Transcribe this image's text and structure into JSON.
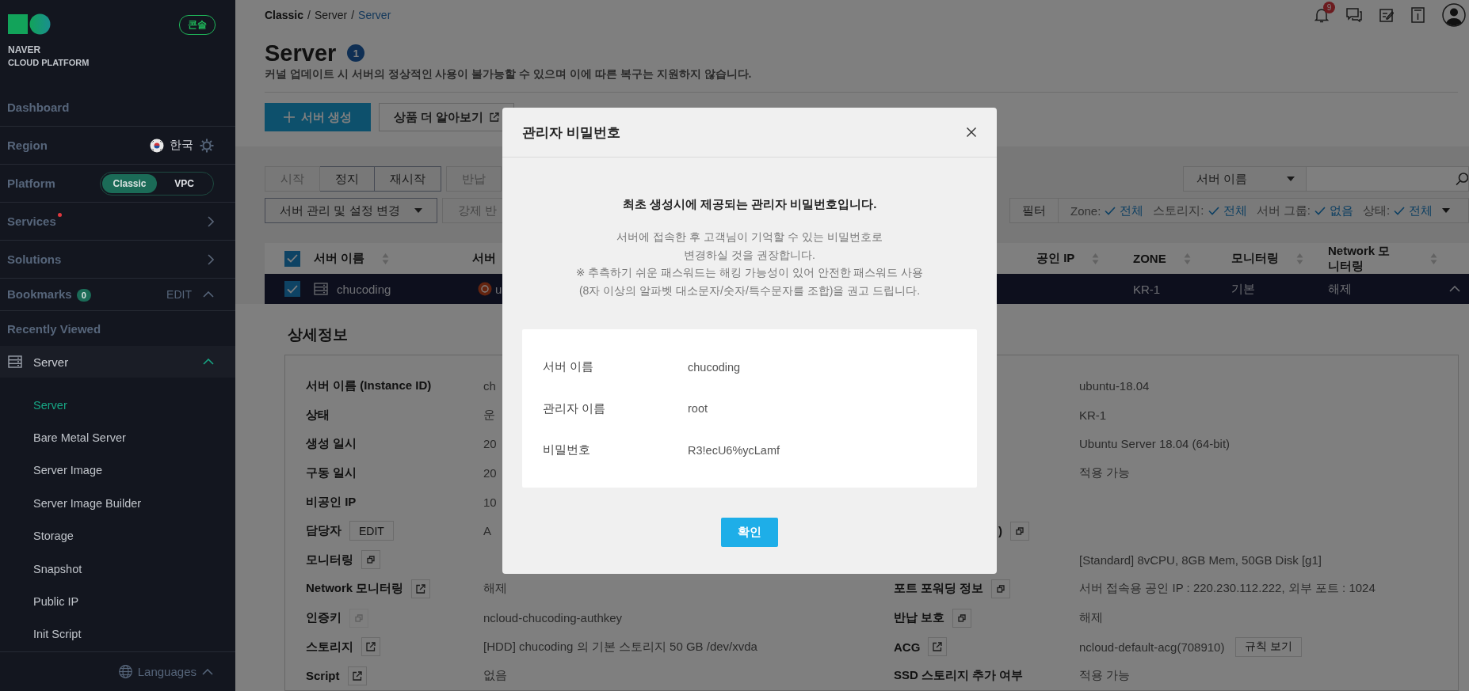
{
  "sidebar": {
    "brand": [
      "NAVER",
      "CLOUD PLATFORM"
    ],
    "console_badge": "콘솔",
    "menu": [
      {
        "kind": "link",
        "label": "Dashboard"
      },
      {
        "kind": "region",
        "label": "Region",
        "value": "한국"
      },
      {
        "kind": "platform",
        "label": "Platform",
        "options": [
          {
            "label": "Classic",
            "selected": true
          },
          {
            "label": "VPC",
            "selected": false
          }
        ]
      },
      {
        "kind": "expander",
        "label": "Services",
        "new": true
      },
      {
        "kind": "expander",
        "label": "Solutions",
        "new": false
      },
      {
        "kind": "bookmarks",
        "label": "Bookmarks",
        "count": "0",
        "action": "EDIT",
        "expanded": true
      },
      {
        "kind": "link",
        "label": "Recently Viewed"
      }
    ],
    "group": {
      "label": "Server",
      "expanded": true,
      "children": [
        {
          "label": "Server",
          "selected": true
        },
        {
          "label": "Bare Metal Server",
          "selected": false
        },
        {
          "label": "Server Image",
          "selected": false
        },
        {
          "label": "Server Image Builder",
          "selected": false
        },
        {
          "label": "Storage",
          "selected": false
        },
        {
          "label": "Snapshot",
          "selected": false
        },
        {
          "label": "Public IP",
          "selected": false
        },
        {
          "label": "Init Script",
          "selected": false
        }
      ]
    },
    "footer": "Languages"
  },
  "breadcrumb": {
    "separator": "/",
    "items": [
      {
        "label": "Classic",
        "current": false
      },
      {
        "label": "Server",
        "current": false
      },
      {
        "label": "Server",
        "current": true
      }
    ]
  },
  "header": {
    "notifications": "9"
  },
  "page": {
    "title": "Server",
    "count": "1",
    "notice": "커널 업데이트 시 서버의 정상적인 사용이 불가능할 수 있으며 이에 따른 복구는 지원하지 않습니다."
  },
  "actions": [
    {
      "kind": "primary",
      "label": "서버 생성"
    },
    {
      "kind": "external",
      "label": "상품 더 알아보기"
    }
  ],
  "toolbar": {
    "row_1": [
      [
        {
          "label": "시작",
          "disabled": true
        },
        {
          "label": "정지",
          "disabled": false
        },
        {
          "label": "재시작",
          "disabled": false
        }
      ],
      [
        {
          "label": "반납",
          "disabled": true
        }
      ]
    ],
    "row_2": [
      [
        {
          "label": "서버 관리 및 설정 변경",
          "kind": "dropdown",
          "disabled": false
        }
      ],
      [
        {
          "label": "강제 반",
          "kind": "plain",
          "disabled": true
        }
      ]
    ]
  },
  "search": {
    "scope": "서버 이름"
  },
  "filter": {
    "button": "필터",
    "items": [
      {
        "name": "Zone:",
        "value": "전체"
      },
      {
        "name": "스토리지:",
        "value": "전체"
      },
      {
        "name": "서버 그룹:",
        "value": "없음"
      },
      {
        "name": "상태:",
        "value": "전체"
      }
    ]
  },
  "table": {
    "all_checked": true,
    "columns": [
      {
        "label": "서버 이름",
        "sortable": true
      },
      {
        "label": "서버"
      },
      {
        "label": "공인 IP",
        "sortable": true
      },
      {
        "label": "ZONE",
        "sortable": true
      },
      {
        "label": "모니터링",
        "sortable": true
      },
      {
        "label": "Network 모니터링",
        "sortable": true
      }
    ],
    "rows": [
      {
        "checked": true,
        "selected": true,
        "expanded": true,
        "name": "chucoding",
        "column_2": "u",
        "zone": "KR-1",
        "monitoring": "기본",
        "network_monitoring": "해제"
      }
    ]
  },
  "details": {
    "title": "상세정보",
    "rows": [
      {
        "label": "서버 이름 (Instance ID)",
        "value": "ch",
        "right_value": "ubuntu-18.04"
      },
      {
        "label": "상태",
        "value": "운",
        "right_value": "KR-1"
      },
      {
        "label": "생성 일시",
        "value": "20",
        "right_value": "Ubuntu Server 18.04 (64-bit)"
      },
      {
        "label": "구동 일시",
        "value": "20",
        "right_value": "적용 가능"
      },
      {
        "label": "비공인 IP",
        "value": "10"
      },
      {
        "label": "담당자",
        "button": "EDIT",
        "value": "A",
        "right_label": ")",
        "right_label_clipped": true,
        "right_icon": {
          "kind": "copy",
          "disabled": false
        }
      },
      {
        "label": "모니터링",
        "icon": {
          "kind": "copy",
          "disabled": false
        },
        "right_value": "[Standard] 8vCPU, 8GB Mem, 50GB Disk [g1]"
      },
      {
        "label": "Network 모니터링",
        "icon": {
          "kind": "external",
          "disabled": false
        },
        "value": "해제",
        "right_label": "포트 포워딩 정보",
        "right_icon": {
          "kind": "copy",
          "disabled": false
        },
        "right_value": "서버 접속용 공인 IP : 220.230.112.222, 외부 포트 : 1024"
      },
      {
        "label": "인증키",
        "icon": {
          "kind": "copy",
          "disabled": true
        },
        "value": "ncloud-chucoding-authkey",
        "right_label": "반납 보호",
        "right_icon": {
          "kind": "copy",
          "disabled": false
        },
        "right_value": "해제"
      },
      {
        "label": "스토리지",
        "icon": {
          "kind": "external",
          "disabled": false
        },
        "value": "[HDD] chucoding 의 기본 스토리지  50 GB /dev/xvda",
        "right_label": "ACG",
        "right_icon": {
          "kind": "external",
          "disabled": false
        },
        "right_value": "ncloud-default-acg(708910)",
        "right_button": "규칙 보기"
      },
      {
        "label": "Script",
        "icon": {
          "kind": "external",
          "disabled": false
        },
        "value": "없음",
        "right_label": "SSD 스토리지 추가 여부",
        "right_value": "적용 가능"
      }
    ]
  },
  "modal": {
    "title": "관리자 비밀번호",
    "heading": "최초 생성시에 제공되는 관리자 비밀번호입니다.",
    "message": [
      "서버에 접속한 후 고객님이 기억할 수 있는 비밀번호로",
      "변경하실 것을 권장합니다.",
      "※ 추측하기 쉬운 패스워드는 해킹 가능성이 있어 안전한 패스워드 사용",
      "(8자 이상의 알파벳 대소문자/숫자/특수문자를 조합)을 권고 드립니다."
    ],
    "fields": [
      {
        "label": "서버 이름",
        "value": "chucoding"
      },
      {
        "label": "관리자 이름",
        "value": "root"
      },
      {
        "label": "비밀번호",
        "value": "R3!ecU6%ycLamf"
      }
    ],
    "confirm": "확인"
  }
}
